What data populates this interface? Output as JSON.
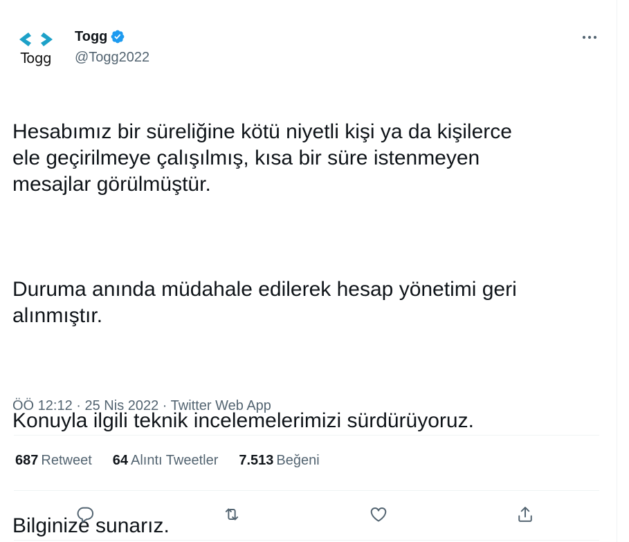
{
  "author": {
    "avatar_text": "Togg",
    "display_name": "Togg",
    "handle": "@Togg2022",
    "verified": true,
    "logo_color": "#1da1c8"
  },
  "tweet": {
    "paragraphs": [
      "Hesabımız bir süreliğine kötü niyetli kişi ya da kişilerce\nele geçirilmeye çalışılmış, kısa bir süre istenmeyen\nmesajlar görülmüştür.",
      "Duruma anında müdahale edilerek hesap yönetimi geri\nalınmıştır.",
      "Konuyla ilgili teknik incelemelerimizi sürdürüyoruz.",
      "Bilginize sunarız."
    ],
    "time": "ÖÖ 12:12",
    "date": "25 Nis 2022",
    "source": "Twitter Web App",
    "separator": " · "
  },
  "stats": {
    "retweets": {
      "count": "687",
      "label": "Retweet"
    },
    "quotes": {
      "count": "64",
      "label": "Alıntı Tweetler"
    },
    "likes": {
      "count": "7.513",
      "label": "Beğeni"
    }
  },
  "actions": [
    {
      "icon": "reply-icon"
    },
    {
      "icon": "retweet-icon"
    },
    {
      "icon": "like-icon"
    },
    {
      "icon": "share-icon"
    }
  ],
  "colors": {
    "text": "#0f1419",
    "secondary": "#536471",
    "verified": "#1d9bf0",
    "divider": "#eff3f4"
  }
}
